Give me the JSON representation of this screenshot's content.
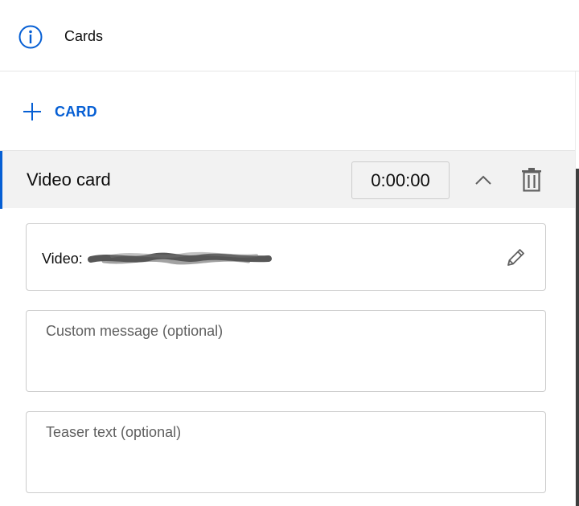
{
  "header": {
    "title": "Cards",
    "icon": "info-icon"
  },
  "add_card": {
    "label": "CARD",
    "icon": "plus-icon",
    "color": "#065fd4"
  },
  "card": {
    "type_label": "Video card",
    "start_time": "0:00:00",
    "video_label": "Video:",
    "video_value_redacted": true,
    "custom_message": {
      "placeholder": "Custom message (optional)",
      "value": ""
    },
    "teaser_text": {
      "placeholder": "Teaser text (optional)",
      "value": ""
    }
  },
  "colors": {
    "accent": "#065fd4",
    "row_background": "#f2f2f2",
    "border": "#cccccc"
  }
}
